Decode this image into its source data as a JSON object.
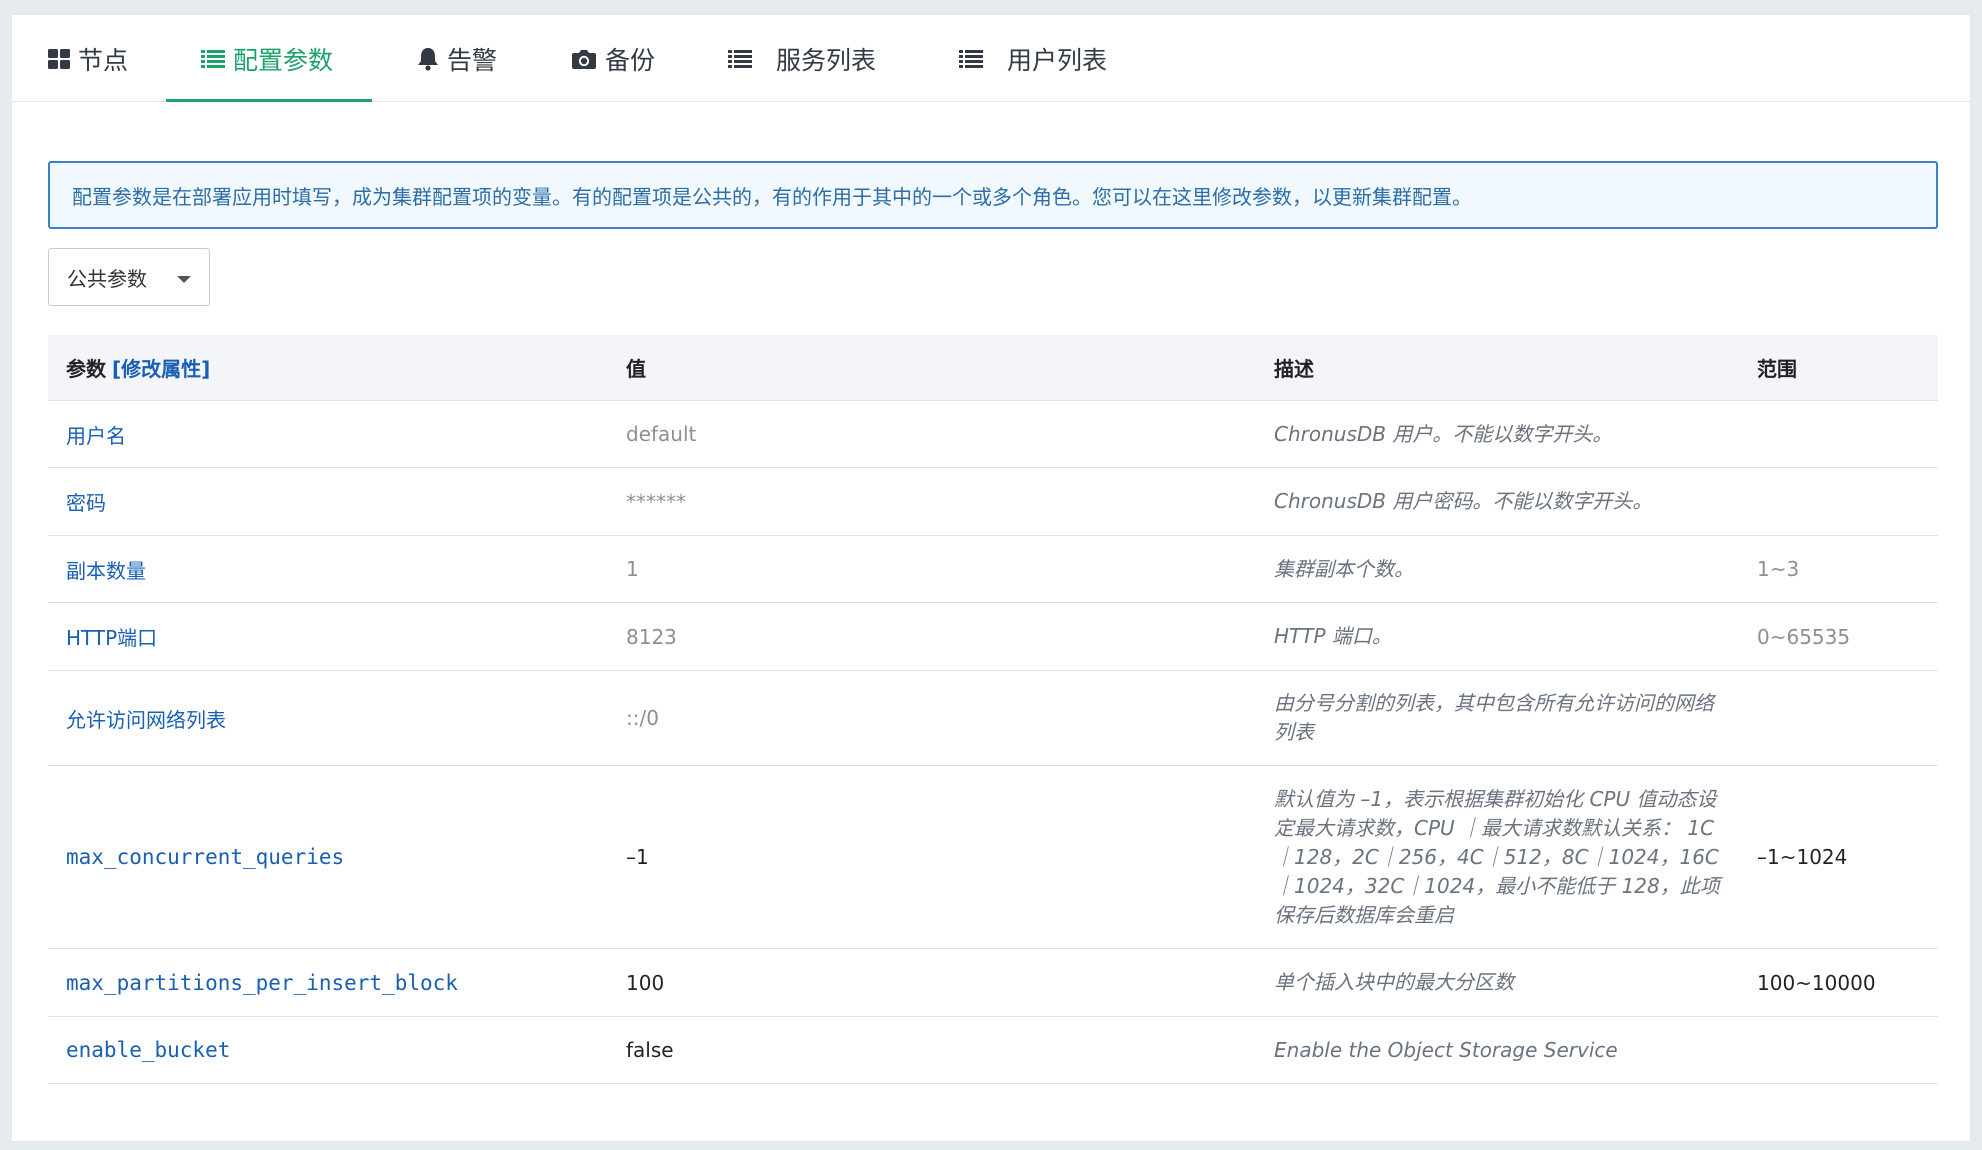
{
  "tabs": [
    {
      "label": "节点",
      "icon": "grid-icon",
      "active": false
    },
    {
      "label": "配置参数",
      "icon": "list-icon",
      "active": true
    },
    {
      "label": "告警",
      "icon": "bell-icon",
      "active": false
    },
    {
      "label": "备份",
      "icon": "camera-icon",
      "active": false
    },
    {
      "label": "服务列表",
      "icon": "list-icon",
      "active": false
    },
    {
      "label": "用户列表",
      "icon": "list-icon",
      "active": false
    }
  ],
  "alert": {
    "text": "配置参数是在部署应用时填写，成为集群配置项的变量。有的配置项是公共的，有的作用于其中的一个或多个角色。您可以在这里修改参数，以更新集群配置。"
  },
  "filter": {
    "selected": "公共参数"
  },
  "table": {
    "headers": {
      "param": "参数",
      "param_link": "[修改属性]",
      "value": "值",
      "desc": "描述",
      "range": "范围"
    },
    "rows": [
      {
        "param": "用户名",
        "value": "default",
        "desc": "ChronusDB 用户。不能以数字开头。",
        "range": ""
      },
      {
        "param": "密码",
        "value": "******",
        "desc": "ChronusDB 用户密码。不能以数字开头。",
        "range": ""
      },
      {
        "param": "副本数量",
        "value": "1",
        "desc": "集群副本个数。",
        "range": "1~3"
      },
      {
        "param": "HTTP端口",
        "value": "8123",
        "desc": "HTTP 端口。",
        "range": "0~65535"
      },
      {
        "param": "允许访问网络列表",
        "value": "::/0",
        "desc": "由分号分割的列表，其中包含所有允许访问的网络列表",
        "range": ""
      },
      {
        "param": "max_concurrent_queries",
        "value": "–1",
        "desc": "默认值为 –1，表示根据集群初始化 CPU 值动态设定最大请求数，CPU ｜最大请求数默认关系： 1C｜128，2C｜256，4C｜512，8C｜1024，16C｜1024，32C｜1024，最小不能低于 128，此项保存后数据库会重启",
        "range": "–1~1024"
      },
      {
        "param": "max_partitions_per_insert_block",
        "value": "100",
        "desc": "单个插入块中的最大分区数",
        "range": "100~10000"
      },
      {
        "param": "enable_bucket",
        "value": "false",
        "desc": "Enable the Object Storage Service",
        "range": ""
      }
    ]
  },
  "colors": {
    "accent": "#1aa36a",
    "link": "#1a5fb4",
    "alert_border": "#3b82c4"
  }
}
